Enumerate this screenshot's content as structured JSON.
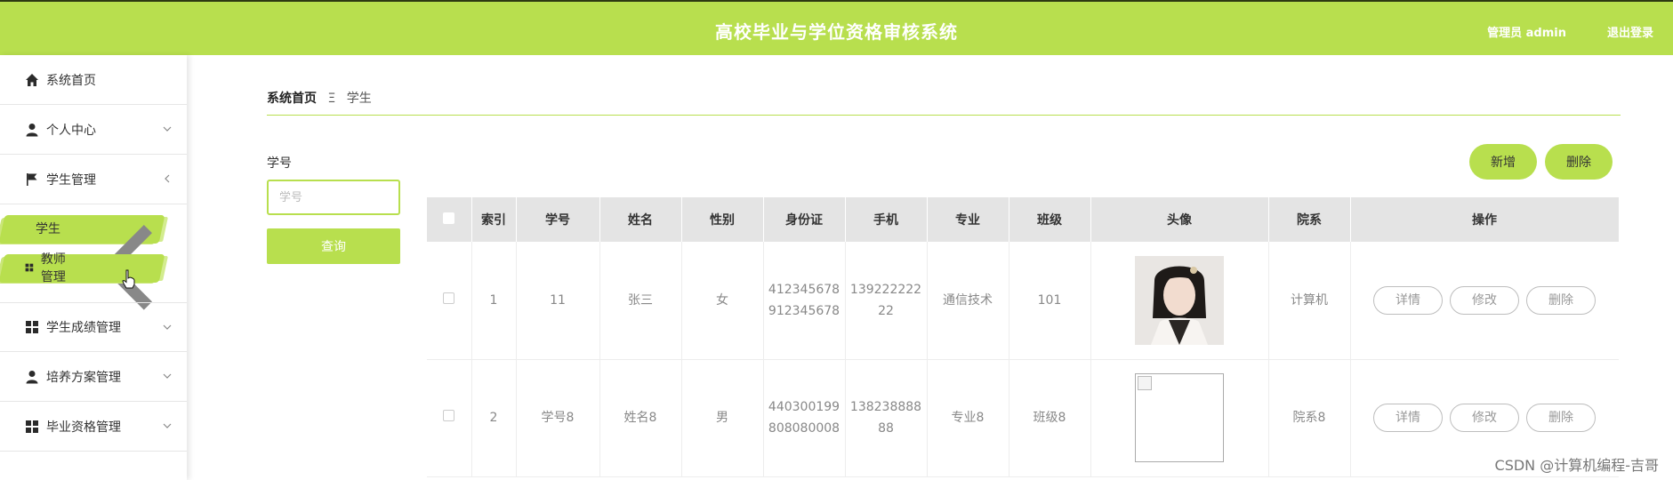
{
  "header": {
    "title": "高校毕业与学位资格审核系统",
    "admin_label": "管理员 admin",
    "logout_label": "退出登录",
    "accent_color": "#b8df4e"
  },
  "sidebar": {
    "items": [
      {
        "label": "系统首页",
        "icon": "home-icon"
      },
      {
        "label": "个人中心",
        "icon": "user-icon",
        "chevron": "down"
      },
      {
        "label": "学生管理",
        "icon": "flag-icon",
        "chevron": "left"
      },
      {
        "label": "学生",
        "sub": true,
        "active": true
      },
      {
        "label": "教师管理",
        "icon": "grid-icon",
        "chevron": "left",
        "active": true
      },
      {
        "label": "学生成绩管理",
        "icon": "grid-icon",
        "chevron": "down"
      },
      {
        "label": "培养方案管理",
        "icon": "user-icon",
        "chevron": "down"
      },
      {
        "label": "毕业资格管理",
        "icon": "grid-icon",
        "chevron": "down"
      }
    ]
  },
  "breadcrumb": {
    "home": "系统首页",
    "separator": "Ξ",
    "current": "学生"
  },
  "search": {
    "label": "学号",
    "placeholder": "学号",
    "query_button": "查询"
  },
  "actions": {
    "add_label": "新增",
    "delete_label": "删除"
  },
  "table": {
    "columns": [
      "",
      "索引",
      "学号",
      "姓名",
      "性别",
      "身份证",
      "手机",
      "专业",
      "班级",
      "头像",
      "院系",
      "操作"
    ],
    "rows": [
      {
        "index": "1",
        "student_no": "11",
        "name": "张三",
        "gender": "女",
        "id_card": "412345678912345678",
        "phone": "13922222222",
        "major": "通信技术",
        "class": "101",
        "avatar": "photo",
        "department": "计算机"
      },
      {
        "index": "2",
        "student_no": "学号8",
        "name": "姓名8",
        "gender": "男",
        "id_card": "440300199808080008",
        "phone": "13823888888",
        "major": "专业8",
        "class": "班级8",
        "avatar": "broken",
        "department": "院系8"
      }
    ],
    "row_actions": {
      "detail": "详情",
      "edit": "修改",
      "delete": "删除"
    }
  },
  "watermark": "CSDN @计算机编程-吉哥"
}
